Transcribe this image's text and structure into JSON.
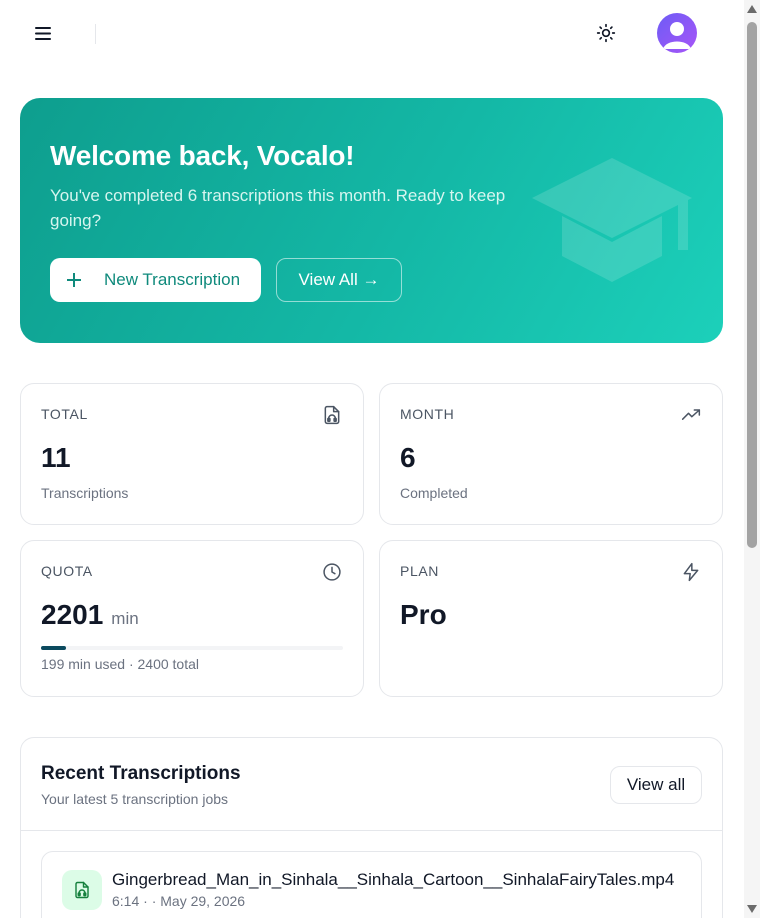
{
  "topbar": {
    "menu_icon": "menu-icon",
    "theme_icon": "sun-icon",
    "avatar_icon": "user-avatar"
  },
  "hero": {
    "title": "Welcome back, Vocalo!",
    "subtitle": "You've completed 6 transcriptions this month. Ready to keep going?",
    "new_button": "New Transcription",
    "view_all_button": "View All →",
    "decor_icon": "graduation-cap-icon"
  },
  "stats": {
    "total": {
      "label": "TOTAL",
      "value": "11",
      "caption": "Transcriptions",
      "icon": "audio-file-icon"
    },
    "month": {
      "label": "MONTH",
      "value": "6",
      "caption": "Completed",
      "icon": "trending-up-icon"
    },
    "quota": {
      "label": "QUOTA",
      "value": "2201",
      "unit": "min",
      "caption": "199 min used · 2400 total",
      "used_fraction": 0.083,
      "icon": "clock-icon"
    },
    "plan": {
      "label": "PLAN",
      "value": "Pro",
      "icon": "zap-icon"
    }
  },
  "recent": {
    "title": "Recent Transcriptions",
    "subtitle": "Your latest 5 transcription jobs",
    "view_all": "View all",
    "items": [
      {
        "name": "Gingerbread_Man_in_Sinhala__Sinhala_Cartoon__SinhalaFairyTales.mp4",
        "meta": "6:14 · · May 29, 2026",
        "icon": "audio-file-icon"
      }
    ]
  },
  "colors": {
    "accent": "#14b8a6",
    "brand_dark": "#0b4a5e",
    "avatar": "#8b5cf6"
  }
}
